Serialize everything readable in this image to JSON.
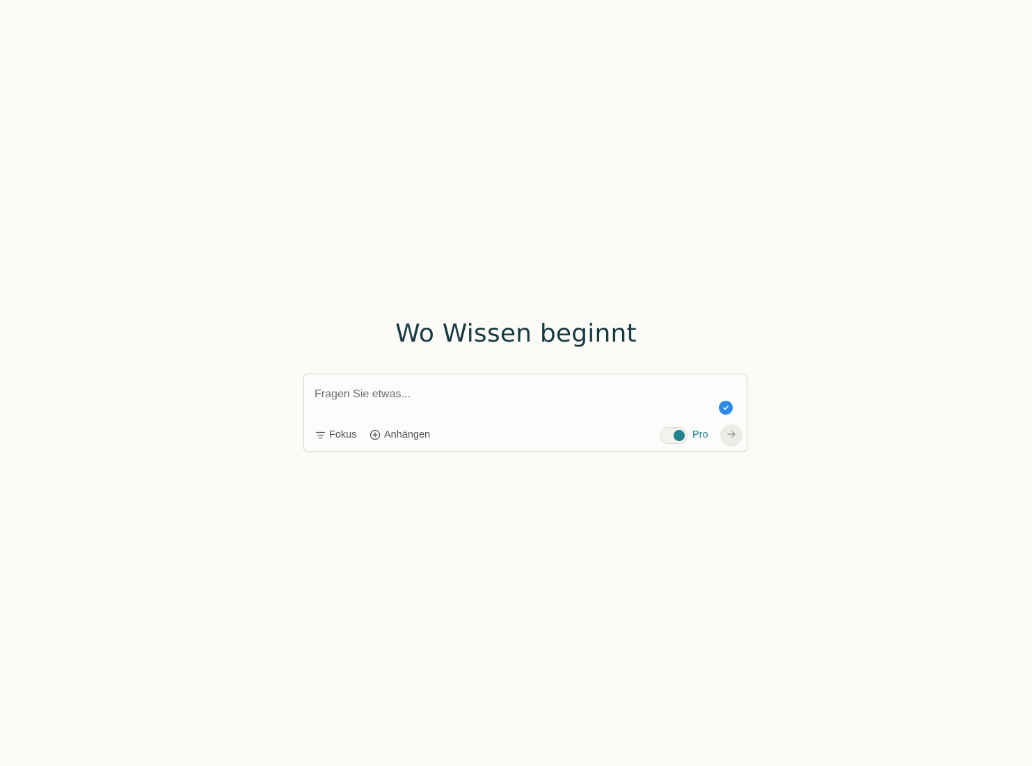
{
  "hero": {
    "headline": "Wo Wissen beginnt"
  },
  "search": {
    "placeholder": "Fragen Sie etwas...",
    "value": ""
  },
  "toolbar": {
    "focus_label": "Fokus",
    "attach_label": "Anhängen",
    "pro_label": "Pro",
    "pro_enabled": true
  },
  "icons": {
    "focus": "filter-lines-icon",
    "attach": "plus-circle-icon",
    "status": "check-circle-icon",
    "submit": "arrow-right-icon"
  },
  "colors": {
    "background": "#fbfbf8",
    "headline": "#1a3a42",
    "accent": "#20808d",
    "check_badge": "#2b8be6"
  }
}
